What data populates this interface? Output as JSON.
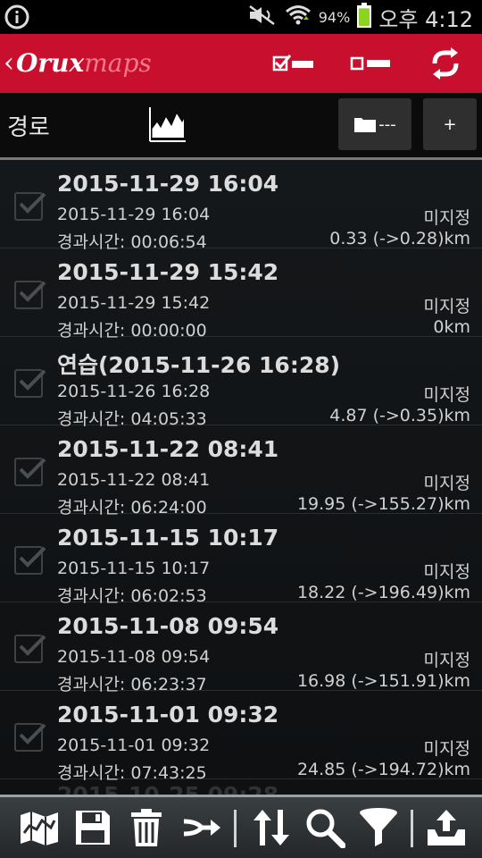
{
  "status_bar": {
    "left_icon": "info-circle-icon",
    "icons": [
      "mute-icon",
      "wifi-icon"
    ],
    "battery_percent": "94%",
    "time": "오후 4:12",
    "battery_level": 0.94
  },
  "app_bar": {
    "logo_part1": "Orux",
    "logo_part2": "maps",
    "back_glyph": "‹",
    "buttons": [
      "select-all-icon",
      "deselect-all-icon",
      "sync-icon"
    ],
    "accent_color": "#c8102e"
  },
  "sub_bar": {
    "title": "경로",
    "chart_icon": "elevation-chart-icon",
    "folder_button_label": "---",
    "add_button_label": "+"
  },
  "tracks": [
    {
      "title": "2015-11-29 16:04",
      "date": "2015-11-29 16:04",
      "status": "미지정",
      "elapsed": "경과시간: 00:06:54",
      "distance": "0.33 (->0.28)km"
    },
    {
      "title": "2015-11-29 15:42",
      "date": "2015-11-29 15:42",
      "status": "미지정",
      "elapsed": "경과시간: 00:00:00",
      "distance": "0km"
    },
    {
      "title": "연습(2015-11-26 16:28)",
      "date": "2015-11-26 16:28",
      "status": "미지정",
      "elapsed": "경과시간: 04:05:33",
      "distance": "4.87 (->0.35)km"
    },
    {
      "title": "2015-11-22 08:41",
      "date": "2015-11-22 08:41",
      "status": "미지정",
      "elapsed": "경과시간: 06:24:00",
      "distance": "19.95 (->155.27)km"
    },
    {
      "title": "2015-11-15 10:17",
      "date": "2015-11-15 10:17",
      "status": "미지정",
      "elapsed": "경과시간: 06:02:53",
      "distance": "18.22 (->196.49)km"
    },
    {
      "title": "2015-11-08 09:54",
      "date": "2015-11-08 09:54",
      "status": "미지정",
      "elapsed": "경과시간: 06:23:37",
      "distance": "16.98 (->151.91)km"
    },
    {
      "title": "2015-11-01 09:32",
      "date": "2015-11-01 09:32",
      "status": "미지정",
      "elapsed": "경과시간: 07:43:25",
      "distance": "24.85 (->194.72)km"
    }
  ],
  "bottom_bar": {
    "buttons": [
      "map-icon",
      "save-icon",
      "trash-icon",
      "merge-icon",
      "sort-icon",
      "search-icon",
      "filter-icon",
      "upload-icon"
    ]
  }
}
